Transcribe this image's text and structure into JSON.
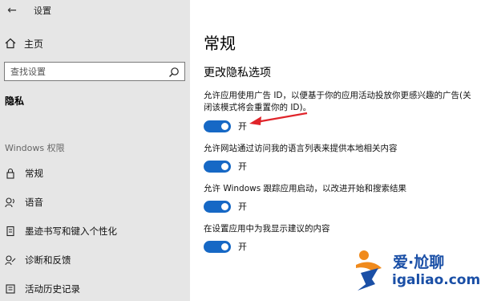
{
  "window": {
    "title": "设置",
    "back_glyph": "←"
  },
  "sidebar": {
    "home_label": "主页",
    "search_placeholder": "查找设置",
    "current_section": "隐私",
    "group_header": "Windows 权限",
    "items": [
      {
        "label": "常规",
        "icon": "lock-icon"
      },
      {
        "label": "语音",
        "icon": "speech-icon"
      },
      {
        "label": "墨迹书写和键入个性化",
        "icon": "pen-icon"
      },
      {
        "label": "诊断和反馈",
        "icon": "feedback-icon"
      },
      {
        "label": "活动历史记录",
        "icon": "history-icon"
      }
    ]
  },
  "main": {
    "title": "常规",
    "subheading": "更改隐私选项",
    "options": [
      {
        "description": "允许应用使用广告 ID，以便基于你的应用活动投放你更感兴趣的广告(关闭该模式将会重置你的 ID)。",
        "state_label": "开",
        "on": true
      },
      {
        "description": "允许网站通过访问我的语言列表来提供本地相关内容",
        "state_label": "开",
        "on": true
      },
      {
        "description": "允许 Windows 跟踪应用启动，以改进开始和搜索结果",
        "state_label": "开",
        "on": true
      },
      {
        "description": "在设置应用中为我显示建议的内容",
        "state_label": "开",
        "on": true
      }
    ]
  },
  "watermark": {
    "brand": "爱·尬聊",
    "url": "igaliao.com"
  },
  "colors": {
    "sidebar_bg": "#e6e6e6",
    "toggle_on": "#1668c5",
    "annotation": "#e0242a",
    "watermark_blue": "#1a4fa6",
    "watermark_orange": "#f08a1c"
  }
}
